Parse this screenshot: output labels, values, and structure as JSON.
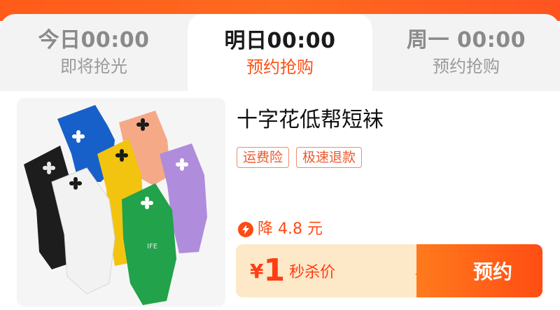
{
  "tabs": [
    {
      "time": "今日00:00",
      "status": "即将抢光",
      "active": false
    },
    {
      "time": "明日00:00",
      "status": "预约抢购",
      "active": true
    },
    {
      "time": "周一 00:00",
      "status": "预约抢购",
      "active": false
    }
  ],
  "product": {
    "title": "十字花低帮短袜",
    "image_icon": "socks-image",
    "tags": [
      "运费险",
      "极速退款"
    ],
    "discount_text": "降 4.8 元",
    "price_symbol": "¥",
    "price_value": "1",
    "price_label": "秒杀价",
    "reserve_label": "预约",
    "sock_brand_text": "IFE"
  },
  "colors": {
    "accent": "#ff4f12",
    "top_strip": "#ff5b1a",
    "buy_bar_bg": "#fde8c8",
    "button_start": "#ff7a1c",
    "button_end": "#ff4d14"
  }
}
